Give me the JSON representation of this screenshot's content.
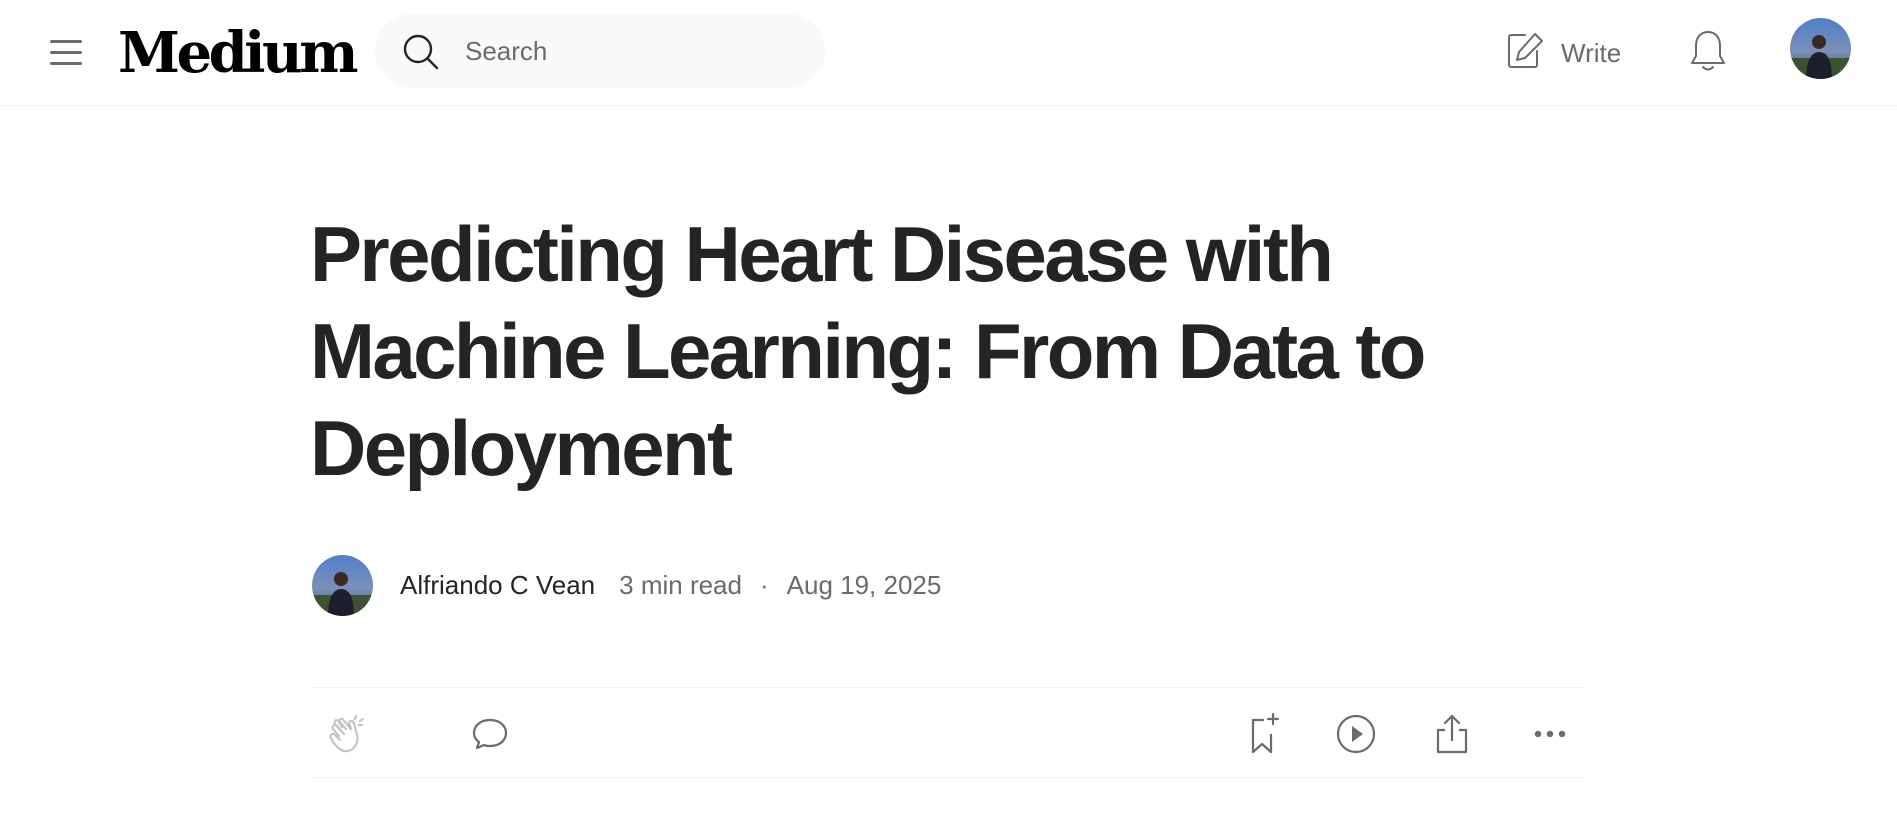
{
  "header": {
    "logo": "Medium",
    "search": {
      "placeholder": "Search",
      "value": ""
    },
    "write_label": "Write"
  },
  "icons": {
    "menu": "hamburger-menu-icon",
    "search": "search-icon",
    "write": "edit-icon",
    "notifications": "bell-icon",
    "clap": "clap-icon",
    "comment": "comment-icon",
    "save": "bookmark-add-icon",
    "listen": "play-icon",
    "share": "share-icon",
    "more": "more-dots-icon"
  },
  "article": {
    "title": "Predicting Heart Disease with Machine Learning: From Data to Deployment",
    "author": "Alfriando C Vean",
    "read_time": "3 min read",
    "separator": "·",
    "date": "Aug 19, 2025"
  },
  "colors": {
    "text_primary": "#242424",
    "text_secondary": "#6b6b6b",
    "divider": "#f0f0f0",
    "search_bg": "#f9f9f9"
  }
}
